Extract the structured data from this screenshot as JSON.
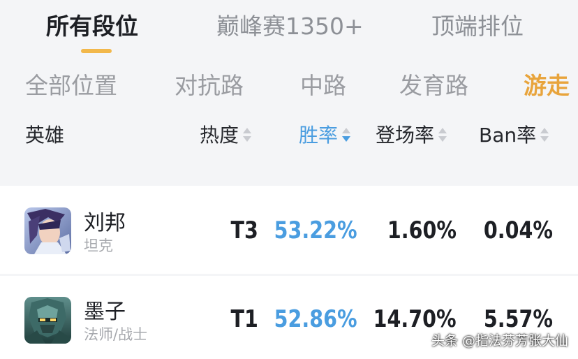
{
  "rank_tabs": [
    {
      "label": "所有段位",
      "active": true
    },
    {
      "label": "巅峰赛1350+",
      "active": false
    },
    {
      "label": "顶端排位",
      "active": false
    }
  ],
  "position_tabs": [
    {
      "label": "全部位置",
      "active": false
    },
    {
      "label": "对抗路",
      "active": false
    },
    {
      "label": "中路",
      "active": false
    },
    {
      "label": "发育路",
      "active": false
    },
    {
      "label": "游走",
      "active": true
    }
  ],
  "table": {
    "headers": {
      "hero": "英雄",
      "heat": "热度",
      "win_rate": "胜率",
      "pick_rate": "登场率",
      "ban_rate": "Ban率"
    },
    "sorted_by": "win_rate",
    "sort_direction": "desc",
    "rows": [
      {
        "name": "刘邦",
        "role": "坦克",
        "heat": "T3",
        "win_rate": "53.22%",
        "pick_rate": "1.60%",
        "ban_rate": "0.04%"
      },
      {
        "name": "墨子",
        "role": "法师/战士",
        "heat": "T1",
        "win_rate": "52.86%",
        "pick_rate": "14.70%",
        "ban_rate": "5.57%"
      }
    ]
  },
  "watermark": "头条 @指法芬芳张大仙",
  "colors": {
    "accent_orange": "#f2b84b",
    "accent_blue": "#4a9de0"
  }
}
